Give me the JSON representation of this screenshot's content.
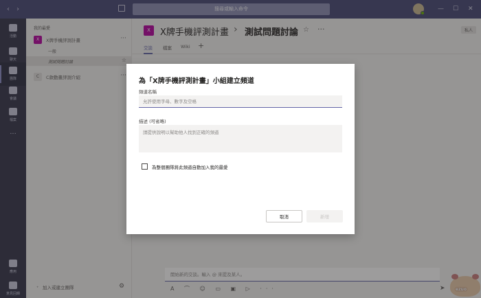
{
  "titlebar": {
    "back_icon": "‹",
    "forward_icon": "›",
    "search_placeholder": "搜尋或輸入命令",
    "minimize": "—",
    "maximize": "☐",
    "close": "✕"
  },
  "appbar": {
    "items": [
      {
        "label": "活動",
        "icon": "bell-icon"
      },
      {
        "label": "聊天",
        "icon": "chat-icon"
      },
      {
        "label": "團隊",
        "icon": "teams-icon"
      },
      {
        "label": "會議",
        "icon": "calendar-icon"
      },
      {
        "label": "檔案",
        "icon": "files-icon"
      }
    ],
    "more": "···",
    "bottom": [
      {
        "label": "應用",
        "icon": "apps-icon"
      },
      {
        "label": "意見回饋",
        "icon": "lightbulb-icon"
      }
    ]
  },
  "sidebar": {
    "section_label": "我的最愛",
    "teams": [
      {
        "initial": "X",
        "name": "X牌手機評測計畫",
        "color": "#b4009e",
        "channels": [
          {
            "name": "一般"
          },
          {
            "name": "測試問題討論"
          }
        ]
      },
      {
        "initial": "C",
        "name": "C款動畫評測介紹",
        "color": "#e1dfdd"
      }
    ],
    "more_icon": "···",
    "star_icon": "☆",
    "join_label": "加入或建立團隊",
    "settings_icon": "⚙"
  },
  "main": {
    "team_initial": "X",
    "team_name": "X牌手機評測計畫",
    "separator": "›",
    "channel_name": "測試問題討論",
    "star": "☆",
    "more": "···",
    "badge": "私人",
    "tabs": [
      {
        "label": "交談"
      },
      {
        "label": "檔案"
      },
      {
        "label": "Wiki"
      }
    ],
    "tab_add": "+",
    "compose_placeholder": "開始新的交談。輸入 @ 來提及某人。",
    "compose_tools": "A ⌒ ☺ ▭ ▣ ▷ ···",
    "send": "➤",
    "watermark": "ezuo"
  },
  "dialog": {
    "title": "為「X牌手機評測計畫」小組建立頻道",
    "name_label": "頻道名稱",
    "name_placeholder": "允許使用字母、數字及空格",
    "desc_label": "描述 (可省略)",
    "desc_placeholder": "請提供說明以幫助他人找到正確的頻道",
    "checkbox_label": "為整個團隊將此頻道自動加入我的最愛",
    "cancel_label": "取消",
    "add_label": "新增"
  }
}
